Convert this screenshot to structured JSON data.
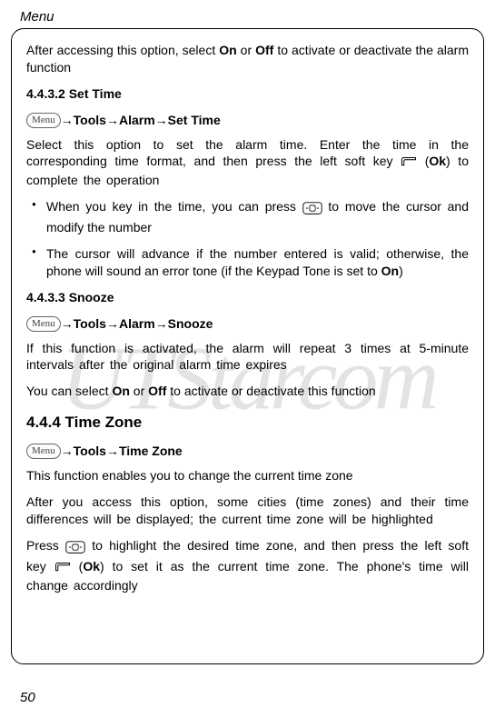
{
  "header": "Menu",
  "intro_para": {
    "prefix": "After accessing this option, select ",
    "bold1": "On",
    "mid1": " or ",
    "bold2": "Off",
    "suffix": " to activate or deactivate the alarm function"
  },
  "settime": {
    "heading": "4.4.3.2 Set Time",
    "menu_label": "Menu",
    "path_bold": "Tools→Alarm→Set Time",
    "para_prefix": "Select this option to set the alarm time. Enter the time in the corresponding time format, and then press the left soft key ",
    "para_mid": " (",
    "para_ok": "Ok",
    "para_suffix": ") to complete the operation",
    "bullet1_prefix": "When you key in the time, you can press ",
    "bullet1_suffix": " to move the cursor and modify the number",
    "bullet2_prefix": "The cursor will advance if the number entered is valid; otherwise, the phone will sound an error tone (if the Keypad Tone is set to ",
    "bullet2_bold": "On",
    "bullet2_suffix": ")"
  },
  "snooze": {
    "heading": "4.4.3.3 Snooze",
    "menu_label": "Menu",
    "path_bold": "Tools→Alarm→Snooze",
    "para1": "If this function is activated, the alarm will repeat 3 times at 5-minute intervals after the original alarm time expires",
    "para2_prefix": "You can select ",
    "para2_b1": "On",
    "para2_mid": " or ",
    "para2_b2": "Off",
    "para2_suffix": " to activate or deactivate this function"
  },
  "timezone": {
    "heading": "4.4.4 Time Zone",
    "menu_label": "Menu",
    "path_bold": "Tools→Time Zone",
    "para1": "This function enables you to change the current time zone",
    "para2": "After you access this option, some cities (time zones) and their time differences will be displayed; the current time zone will be highlighted",
    "para3_prefix": "Press ",
    "para3_mid1": " to highlight the desired time zone, and then press the left soft key ",
    "para3_mid2": " (",
    "para3_ok": "Ok",
    "para3_suffix": ") to set it as the current time zone. The phone's time will change accordingly"
  },
  "watermark": "UTStarcom",
  "page_number": "50"
}
